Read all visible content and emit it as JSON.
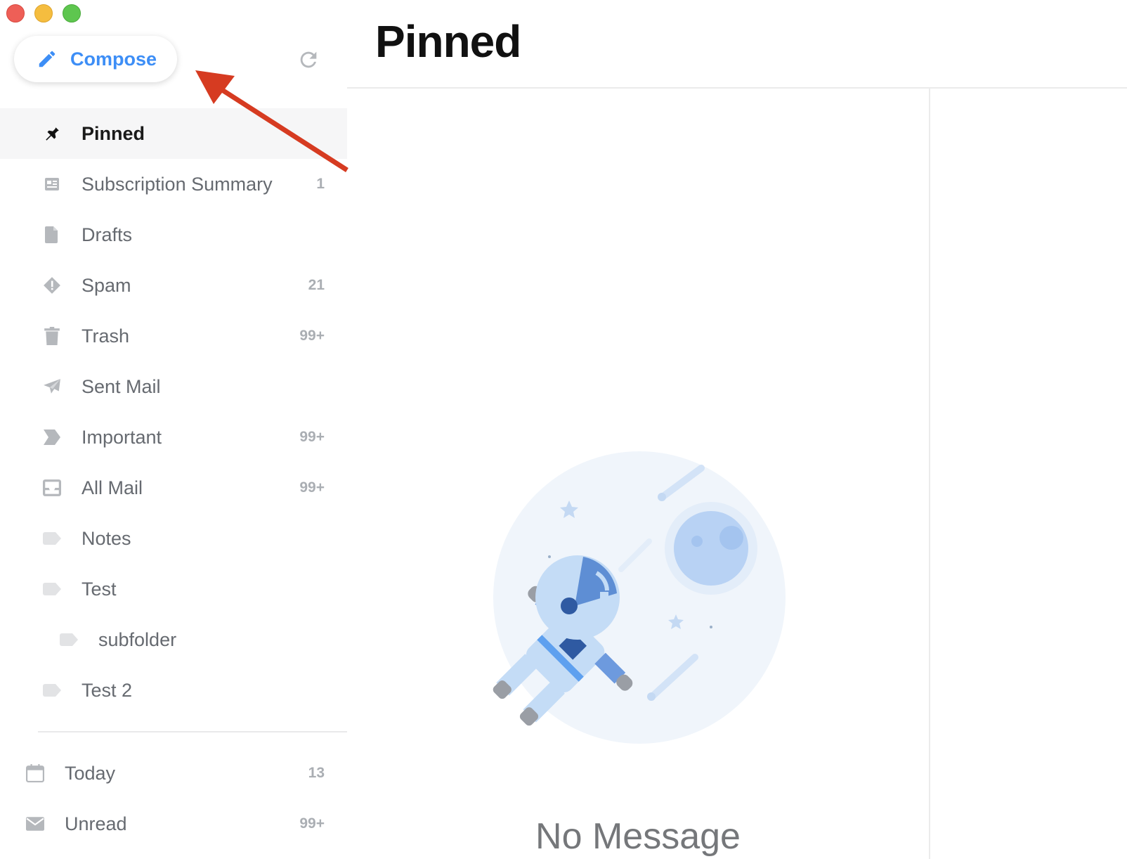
{
  "window": {
    "buttons": [
      "close",
      "minimize",
      "maximize"
    ]
  },
  "sidebar": {
    "compose_label": "Compose",
    "compose_icon": "pencil-icon",
    "refresh_icon": "refresh-icon",
    "folders": [
      {
        "label": "Pinned",
        "count": "",
        "icon": "pin-icon",
        "active": true
      },
      {
        "label": "Subscription Summary",
        "count": "1",
        "icon": "newspaper-icon"
      },
      {
        "label": "Drafts",
        "count": "",
        "icon": "file-icon"
      },
      {
        "label": "Spam",
        "count": "21",
        "icon": "warning-diamond-icon"
      },
      {
        "label": "Trash",
        "count": "99+",
        "icon": "trash-icon"
      },
      {
        "label": "Sent Mail",
        "count": "",
        "icon": "paper-plane-icon"
      },
      {
        "label": "Important",
        "count": "99+",
        "icon": "important-tag-icon"
      },
      {
        "label": "All Mail",
        "count": "99+",
        "icon": "inbox-tray-icon"
      },
      {
        "label": "Notes",
        "count": "",
        "icon": "label-icon"
      },
      {
        "label": "Test",
        "count": "",
        "icon": "label-icon"
      },
      {
        "label": "subfolder",
        "count": "",
        "icon": "label-icon"
      },
      {
        "label": "Test 2",
        "count": "",
        "icon": "label-icon"
      }
    ],
    "smart_folders": [
      {
        "label": "Today",
        "count": "13",
        "icon": "calendar-icon"
      },
      {
        "label": "Unread",
        "count": "99+",
        "icon": "envelope-icon"
      }
    ]
  },
  "main": {
    "title": "Pinned",
    "empty_state": "No Message",
    "illustration": "astronaut-in-space-illustration"
  },
  "colors": {
    "accent": "#3d8ef6",
    "annotation_arrow": "#d63b21",
    "active_row": "#f6f6f7"
  }
}
